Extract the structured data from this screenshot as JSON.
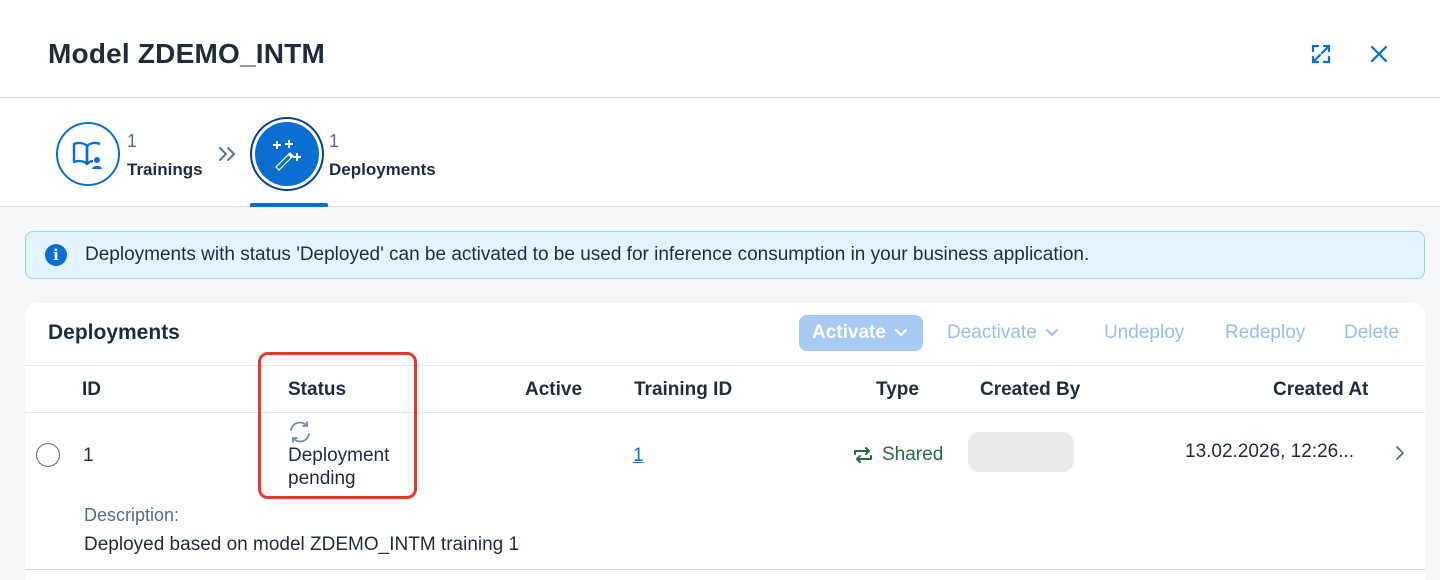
{
  "dialog": {
    "title": "Model ZDEMO_INTM"
  },
  "steps": [
    {
      "count": "1",
      "label": "Trainings",
      "icon": "book-user-icon"
    },
    {
      "count": "1",
      "label": "Deployments",
      "icon": "magic-wand-icon"
    }
  ],
  "info": {
    "message": "Deployments with status 'Deployed' can be activated to be used for inference consumption in your business application."
  },
  "deployments": {
    "title": "Deployments",
    "toolbar": {
      "activate": "Activate",
      "deactivate": "Deactivate",
      "undeploy": "Undeploy",
      "redeploy": "Redeploy",
      "delete": "Delete"
    },
    "columns": {
      "id": "ID",
      "status": "Status",
      "active": "Active",
      "training_id": "Training ID",
      "type": "Type",
      "created_by": "Created By",
      "created_at": "Created At"
    },
    "rows": [
      {
        "id": "1",
        "status": "Deployment pending",
        "active": "",
        "training_id": "1",
        "type": "Shared",
        "created_by": "",
        "created_at": "13.02.2026, 12:26...",
        "description_label": "Description:",
        "description": "Deployed based on model ZDEMO_INTM training 1"
      }
    ]
  },
  "colors": {
    "accent": "#0a6ed1",
    "positive": "#256f3a",
    "highlight": "#e23b2e",
    "info_bg": "#e1f4ff"
  }
}
